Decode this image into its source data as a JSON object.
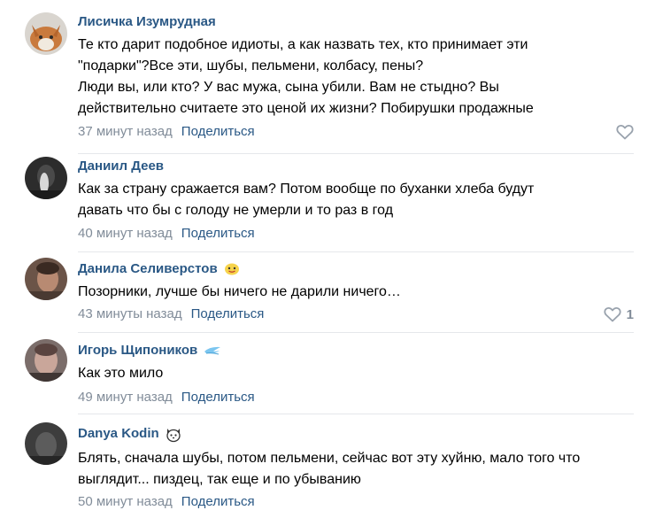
{
  "comments": [
    {
      "author": "Лисичка Изумрудная",
      "text": "Те кто дарит подобное идиоты, а как назвать тех, кто принимает эти\n\"подарки\"?Все эти, шубы, пельмени, колбасу, пены?\nЛюди вы, или кто? У вас мужа, сына убили. Вам не стыдно? Вы\nдействительно считаете это ценой их жизни? Побирушки продажные",
      "time": "37 минут назад",
      "share": "Поделиться",
      "likes": ""
    },
    {
      "author": "Даниил Деев",
      "text": "Как за страну сражается вам? Потом вообще по буханки хлеба будут\nдавать что бы с голоду не умерли и то раз в год",
      "time": "40 минут назад",
      "share": "Поделиться",
      "likes": ""
    },
    {
      "author": "Данила Селиверстов",
      "text": "Позорники, лучше бы ничего не дарили ничего…",
      "time": "43 минуты назад",
      "share": "Поделиться",
      "likes": "1"
    },
    {
      "author": "Игорь Щипоников",
      "text": "Как это мило",
      "time": "49 минут назад",
      "share": "Поделиться",
      "likes": ""
    },
    {
      "author": "Danya Kodin",
      "text": "Блять, сначала шубы, потом пельмени, сейчас вот эту хуйню, мало того что\nвыглядит... пиздец, так еще и по убыванию",
      "time": "50 минут назад",
      "share": "Поделиться",
      "likes": ""
    }
  ],
  "icons": {
    "like": "heart-outline-icon",
    "badge_2": "emoji-face-icon",
    "badge_3": "wings-icon",
    "badge_4": "cat-face-icon"
  },
  "colors": {
    "author": "#2a5885",
    "meta": "#818c99",
    "divider": "#e5e7eb"
  }
}
